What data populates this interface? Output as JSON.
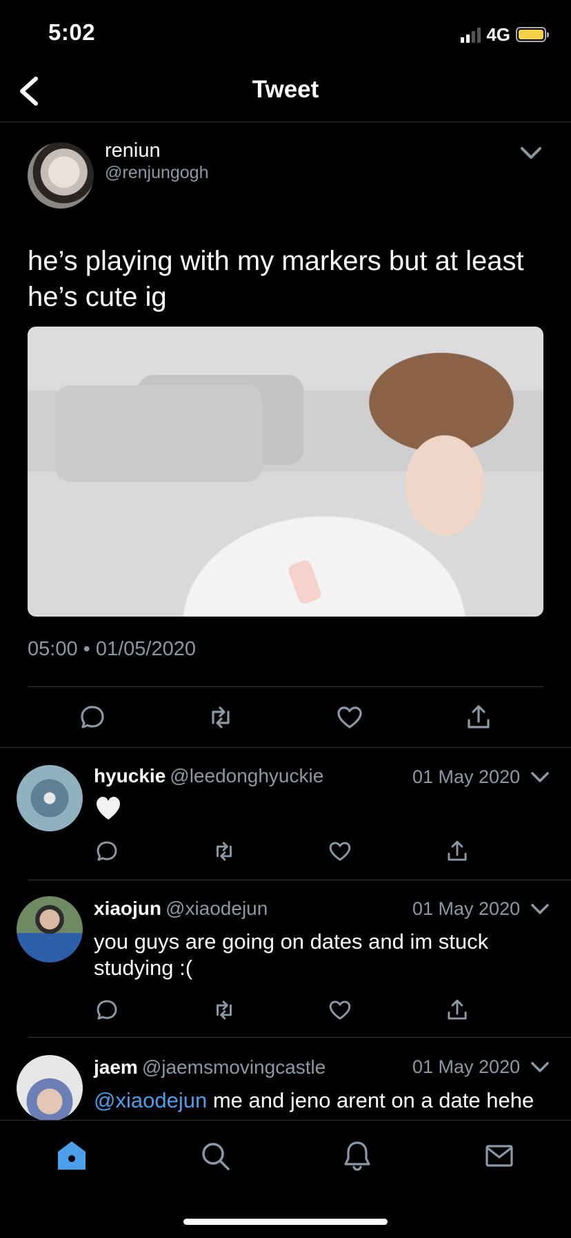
{
  "status_bar": {
    "time": "5:02",
    "network": "4G",
    "battery_color": "#f6d046"
  },
  "header": {
    "title": "Tweet"
  },
  "tweet": {
    "name": "reniun",
    "handle": "@renjungogh",
    "text": "he’s playing with my markers but at least he’s cute ig",
    "timestamp": "05:00 • 01/05/2020"
  },
  "replies": [
    {
      "name": "hyuckie",
      "handle": "@leedonghyuckie",
      "date": "01 May 2020",
      "text": "",
      "emoji": "white-heart"
    },
    {
      "name": "xiaojun",
      "handle": "@xiaodejun",
      "date": "01 May 2020",
      "text": "you guys are going on dates and im stuck studying :("
    },
    {
      "name": "jaem",
      "handle": "@jaemsmovingcastle",
      "date": "01 May 2020",
      "mention": "@xiaodejun",
      "text": " me and jeno arent on a date hehe"
    }
  ],
  "icons": {
    "back": "chevron-left-icon",
    "more": "chevron-down-icon",
    "reply": "reply-icon",
    "retweet": "retweet-icon",
    "like": "heart-icon",
    "share": "share-icon",
    "nav": [
      "home-icon",
      "search-icon",
      "bell-icon",
      "mail-icon"
    ]
  },
  "colors": {
    "accent": "#4a9fe8",
    "muted": "#8b98a5",
    "divider": "#2f3336"
  }
}
